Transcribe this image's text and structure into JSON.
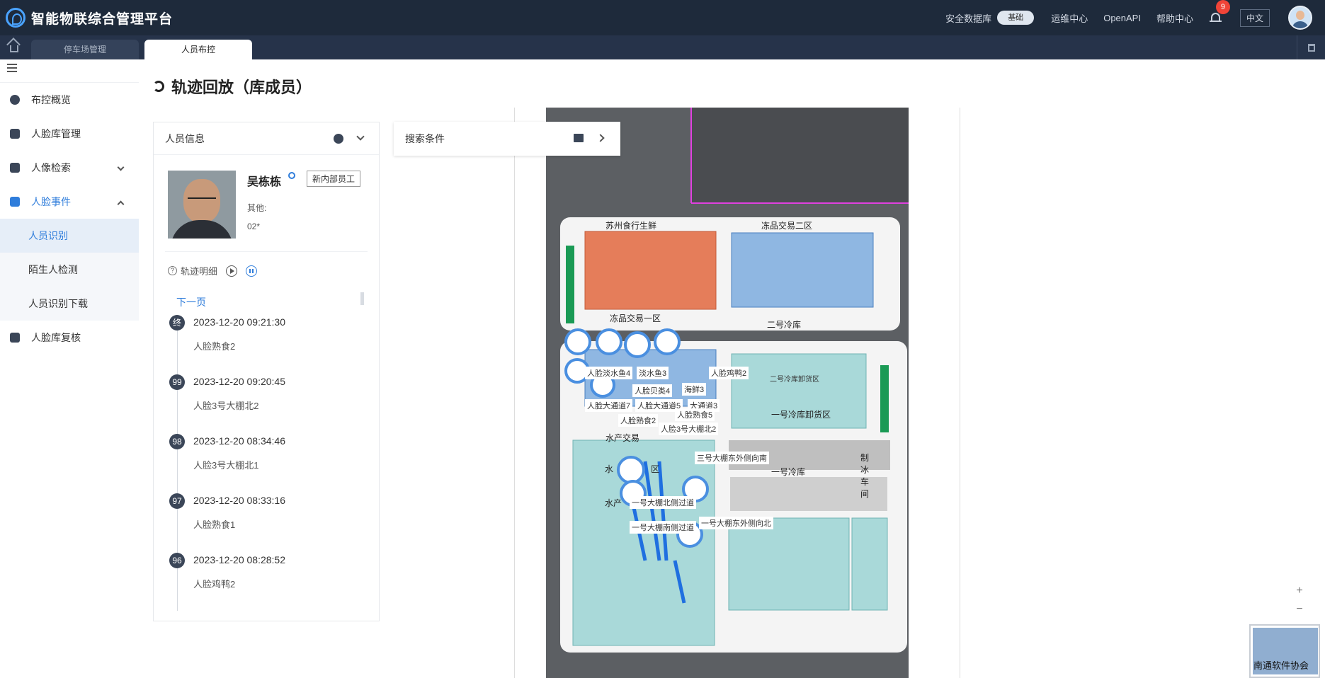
{
  "header": {
    "app_title": "智能物联综合管理平台",
    "security_db_label": "安全数据库",
    "security_db_toggle": "基础",
    "links": [
      "运维中心",
      "OpenAPI",
      "帮助中心"
    ],
    "notification_count": "9",
    "language": "中文"
  },
  "tabs": [
    {
      "label": "停车场管理",
      "active": false
    },
    {
      "label": "人员布控",
      "active": true
    }
  ],
  "sidebar": {
    "items": [
      {
        "label": "布控概览"
      },
      {
        "label": "人脸库管理"
      },
      {
        "label": "人像检索"
      },
      {
        "label": "人脸事件"
      },
      {
        "label": "人脸库复核"
      }
    ],
    "subitems": [
      {
        "label": "人员识别",
        "active": true
      },
      {
        "label": "陌生人检测",
        "active": false
      },
      {
        "label": "人员识别下载",
        "active": false
      }
    ]
  },
  "page": {
    "title": "轨迹回放（库成员）"
  },
  "person_panel": {
    "title": "人员信息",
    "name": "吴栋栋",
    "tag": "新内部员工",
    "other_label": "其他:",
    "other_value": "02*",
    "track_label": "轨迹明细",
    "next_page": "下一页",
    "events": [
      {
        "badge": "终",
        "time": "2023-12-20 09:21:30",
        "place": "人脸熟食2"
      },
      {
        "badge": "99",
        "time": "2023-12-20 09:20:45",
        "place": "人脸3号大棚北2"
      },
      {
        "badge": "98",
        "time": "2023-12-20 08:34:46",
        "place": "人脸3号大棚北1"
      },
      {
        "badge": "97",
        "time": "2023-12-20 08:33:16",
        "place": "人脸熟食1"
      },
      {
        "badge": "96",
        "time": "2023-12-20 08:28:52",
        "place": "人脸鸡鸭2"
      }
    ]
  },
  "search_panel": {
    "title": "搜索条件"
  },
  "map": {
    "zones": [
      "苏州食行生鲜",
      "冻品交易二区",
      "冻品交易一区",
      "二号冷库",
      "二号冷库卸货区",
      "一号冷库卸货区",
      "一号冷库",
      "制冰车间",
      "水产交易",
      "水",
      "区",
      "水产"
    ],
    "camera_labels": [
      "人脸淡水鱼4",
      "淡水鱼3",
      "人脸鸡鸭2",
      "人脸贝类4",
      "海鲜3",
      "人脸大通道7",
      "人脸大通道5",
      "大通道3",
      "人脸熟食2",
      "人脸熟食5",
      "人脸3号大棚北2",
      "三号大棚东外侧向南",
      "一号大棚北侧过道",
      "一号大棚南侧过道",
      "一号大棚东外侧向北"
    ],
    "zoom_in": "+",
    "zoom_out": "−",
    "watermark": "南通软件协会"
  }
}
